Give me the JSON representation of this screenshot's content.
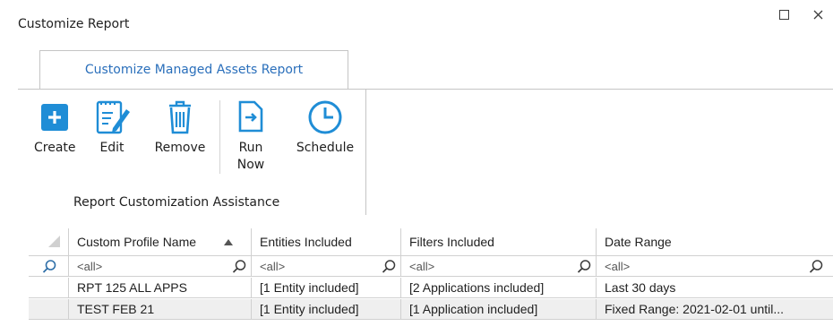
{
  "window": {
    "title": "Customize Report"
  },
  "tab": {
    "label": "Customize Managed Assets Report"
  },
  "ribbon": {
    "buttons": [
      {
        "label": "Create",
        "icon": "plus-icon"
      },
      {
        "label": "Edit",
        "icon": "edit-icon"
      },
      {
        "label": "Remove",
        "icon": "trash-icon"
      },
      {
        "label": "Run\nNow",
        "icon": "run-icon"
      },
      {
        "label": "Schedule",
        "icon": "clock-icon"
      }
    ],
    "group_label": "Report Customization Assistance"
  },
  "grid": {
    "columns": [
      "Custom Profile Name",
      "Entities Included",
      "Filters Included",
      "Date Range"
    ],
    "filters": [
      "<all>",
      "<all>",
      "<all>",
      "<all>"
    ],
    "rows": [
      [
        "RPT 125 ALL APPS",
        "[1 Entity included]",
        "[2 Applications included]",
        "Last 30 days"
      ],
      [
        "TEST FEB 21",
        "[1 Entity included]",
        "[1 Application included]",
        "Fixed Range: 2021-02-01 until..."
      ]
    ]
  },
  "colors": {
    "accent": "#1f8dd6",
    "tab_text": "#2a6fbb"
  }
}
